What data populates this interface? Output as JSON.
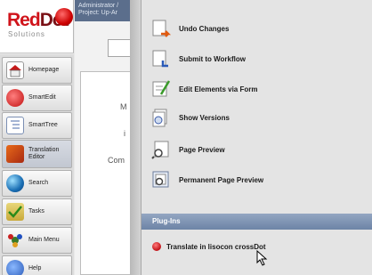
{
  "logo": {
    "brand_part1": "Red",
    "brand_part2": "Dot",
    "tagline": "Solutions"
  },
  "header": {
    "line1": "Administrator /",
    "line2": "Project: Up-Ar"
  },
  "nav": [
    {
      "label": "Homepage",
      "icon": "homepage-icon"
    },
    {
      "label": "SmartEdit",
      "icon": "smartedit-icon"
    },
    {
      "label": "SmartTree",
      "icon": "smarttree-icon"
    },
    {
      "label": "Translation Editor",
      "line1": "Translation",
      "line2": "Editor",
      "icon": "translation-editor-icon"
    },
    {
      "label": "Search",
      "icon": "search-icon"
    },
    {
      "label": "Tasks",
      "icon": "tasks-icon"
    },
    {
      "label": "Main Menu",
      "icon": "main-menu-icon"
    },
    {
      "label": "Help",
      "icon": "help-icon"
    }
  ],
  "mid_text": {
    "letter_m": "M",
    "letter_i": "i",
    "word_com": "Com"
  },
  "menu": {
    "items": [
      {
        "label": "Undo Changes",
        "icon": "undo-changes-icon"
      },
      {
        "label": "Submit to Workflow",
        "icon": "submit-workflow-icon"
      },
      {
        "label": "Edit Elements via Form",
        "icon": "edit-form-icon"
      },
      {
        "label": "Show Versions",
        "icon": "show-versions-icon"
      },
      {
        "label": "Page Preview",
        "icon": "page-preview-icon"
      },
      {
        "label": "Permanent Page Preview",
        "icon": "permanent-preview-icon"
      }
    ],
    "plugins_title": "Plug-Ins",
    "plugin_items": [
      {
        "label": "Translate in lisocon crossDot",
        "icon": "plugin-dot-icon"
      }
    ]
  },
  "colors": {
    "brand_red": "#d0141b",
    "header_blue": "#5b6e8c",
    "plugins_header": "#7a8fb0"
  }
}
